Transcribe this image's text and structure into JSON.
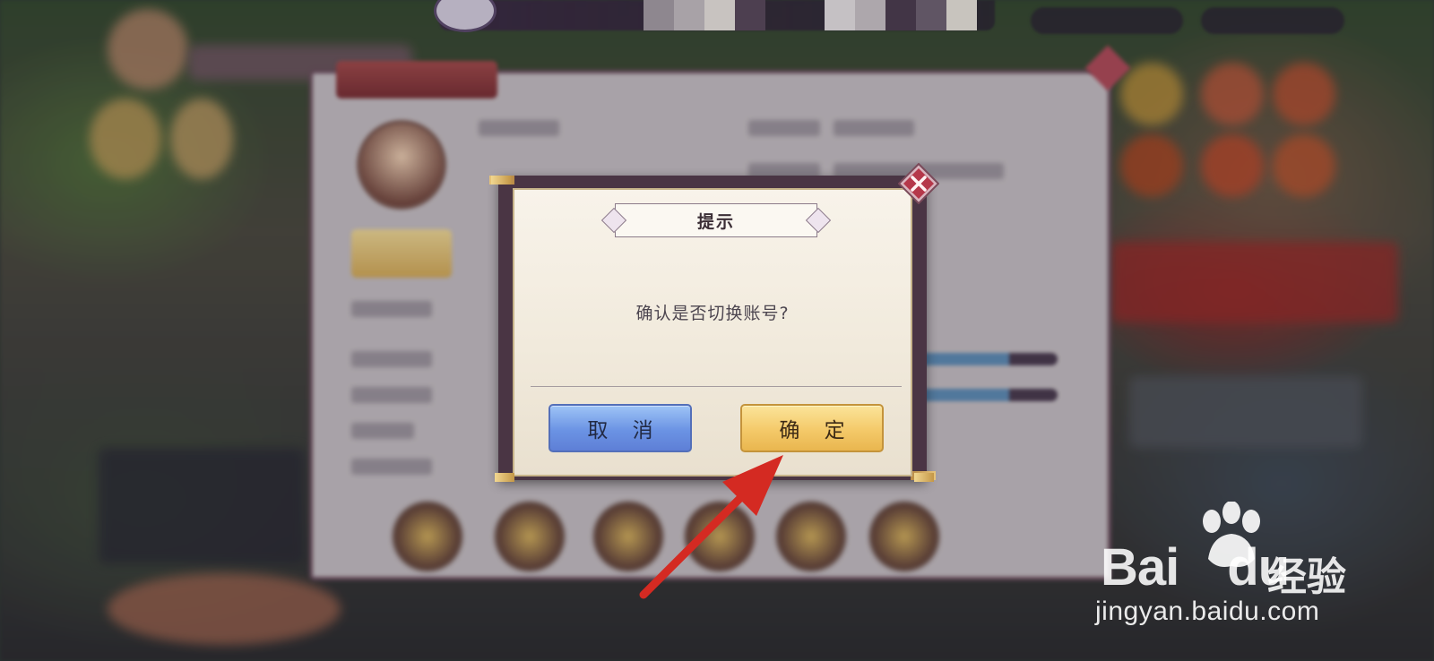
{
  "dialog": {
    "title": "提示",
    "message": "确认是否切换账号?",
    "cancel_label": "取 消",
    "confirm_label": "确 定"
  },
  "watermark": {
    "brand": "Bai",
    "brand_suffix": "du",
    "product": "经验",
    "url": "jingyan.baidu.com"
  },
  "icons": {
    "dialog_close": "close-icon",
    "annotation_arrow": "arrow-icon",
    "watermark_paw": "paw-icon"
  },
  "colors": {
    "cancel_button": "#6b93e4",
    "confirm_button": "#f4c969",
    "arrow": "#d42a22",
    "close_diamond": "#b5384a"
  }
}
